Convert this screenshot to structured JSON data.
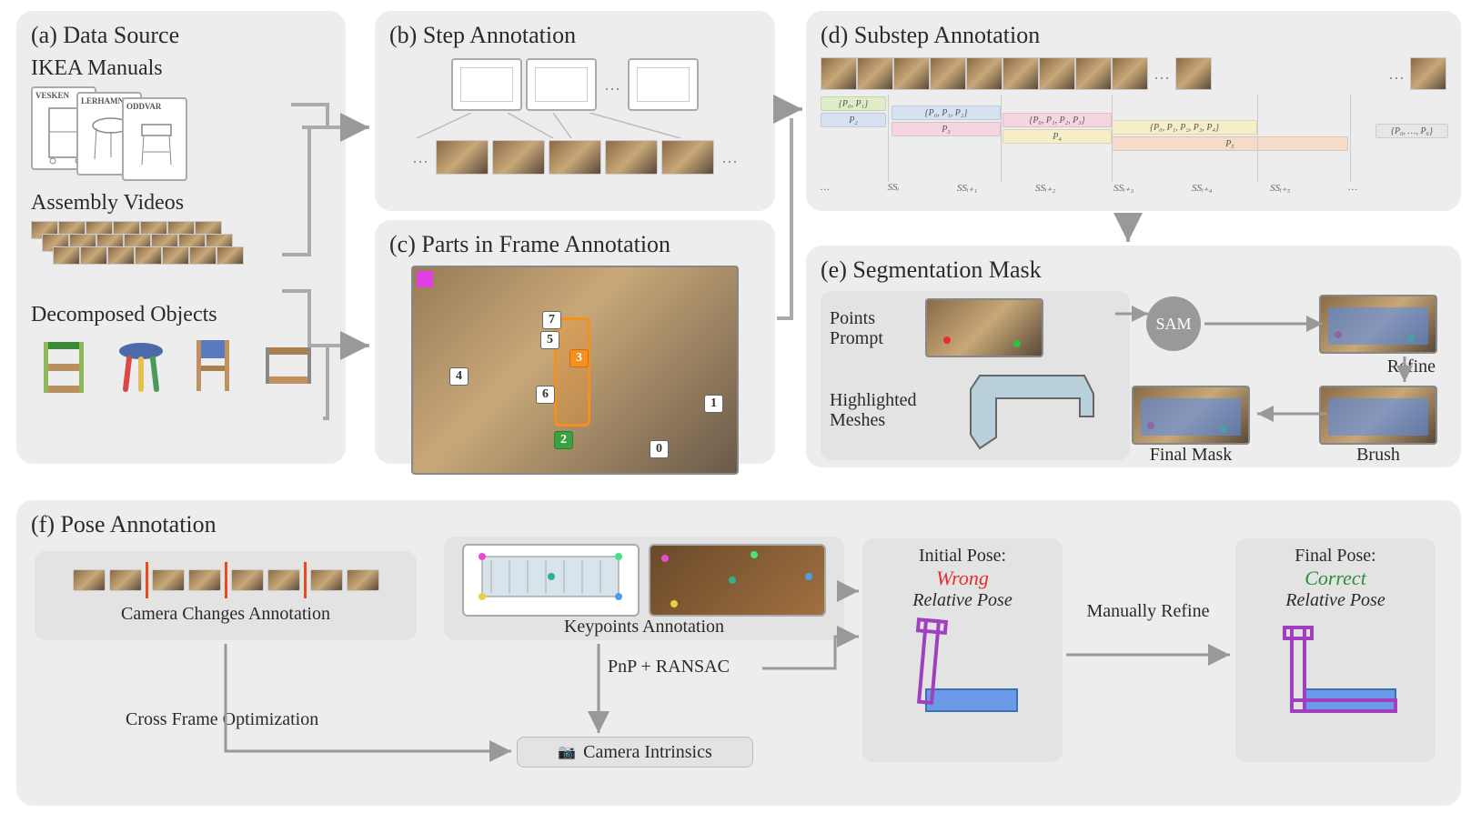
{
  "panels": {
    "a": {
      "title": "(a) Data Source",
      "sub1": "IKEA Manuals",
      "sub2": "Assembly Videos",
      "sub3": "Decomposed Objects",
      "sheet_names": [
        "VESKEN",
        "LERHAMN",
        "ODDVAR"
      ]
    },
    "b": {
      "title": "(b) Step Annotation"
    },
    "c": {
      "title": "(c) Parts in Frame Annotation",
      "part_labels": [
        "0",
        "1",
        "2",
        "3",
        "4",
        "5",
        "6",
        "7"
      ]
    },
    "d": {
      "title": "(d) Substep Annotation",
      "bars": [
        {
          "text": "{P₀, P₁}",
          "color": "#e0ecc8"
        },
        {
          "text": "P₂",
          "color": "#d6e2f2"
        },
        {
          "text": "{P₀, P₁, P₂}",
          "color": "#d6e2f2"
        },
        {
          "text": "P₃",
          "color": "#f5d5e0"
        },
        {
          "text": "{P₀, P₁, P₂, P₃}",
          "color": "#f5d5e0"
        },
        {
          "text": "P₄",
          "color": "#f5eec8"
        },
        {
          "text": "{P₀, P₁, P₂, P₃, P₄}",
          "color": "#f5eec8"
        },
        {
          "text": "P₅",
          "color": "#f5dcc8"
        },
        {
          "text": "{P₀, …, P₆}",
          "color": "#e6e6e6"
        }
      ],
      "ss_labels": [
        "…",
        "SSᵢ",
        "SSᵢ₊₁",
        "SSᵢ₊₂",
        "SSᵢ₊₃",
        "SSᵢ₊₄",
        "SSᵢ₊₅",
        "…"
      ]
    },
    "e": {
      "title": "(e) Segmentation Mask",
      "points_prompt": "Points Prompt",
      "highlighted": "Highlighted Meshes",
      "sam": "SAM",
      "refine": "Refine",
      "brush": "Brush",
      "final_mask": "Final Mask"
    },
    "f": {
      "title": "(f) Pose Annotation",
      "camera_changes": "Camera Changes Annotation",
      "keypoints": "Keypoints Annotation",
      "pnp": "PnP + RANSAC",
      "cross_frame": "Cross Frame Optimization",
      "camera_intrinsics": "Camera Intrinsics",
      "initial_pose": "Initial Pose:",
      "wrong": "Wrong",
      "relative_pose": "Relative Pose",
      "manually_refine": "Manually Refine",
      "final_pose": "Final Pose:",
      "correct": "Correct"
    }
  },
  "camera_icon": "📷"
}
